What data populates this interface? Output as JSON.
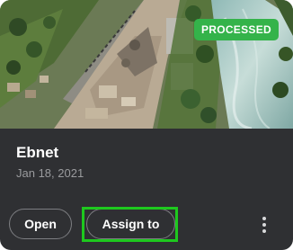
{
  "project": {
    "name": "Ebnet",
    "date": "Jan 18, 2021",
    "status": "PROCESSED",
    "status_color": "#34b34a"
  },
  "actions": {
    "open_label": "Open",
    "assign_label": "Assign to",
    "more_icon": "more-vertical-icon"
  },
  "highlight_color": "#1ec81e"
}
